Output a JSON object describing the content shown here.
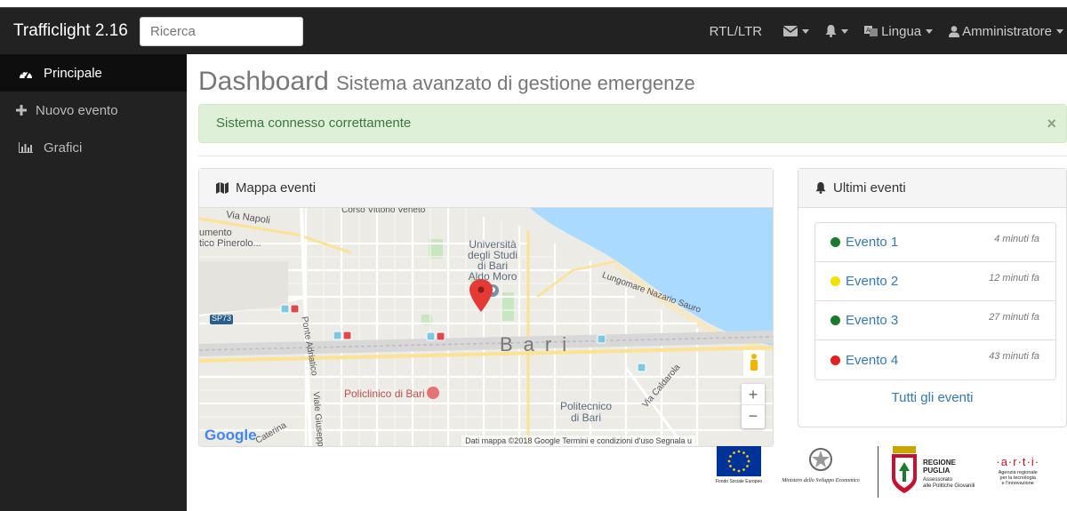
{
  "app": {
    "title": "Trafficlight 2.16"
  },
  "search": {
    "placeholder": "Ricerca"
  },
  "nav": {
    "rtl_ltr": "RTL/LTR",
    "messages_icon": "envelope-icon",
    "alerts_icon": "bell-icon",
    "language": "Lingua",
    "user": "Amministratore"
  },
  "sidebar": {
    "items": [
      {
        "label": "Principale",
        "icon": "dashboard-icon",
        "active": true
      },
      {
        "label": "Nuovo evento",
        "icon": "plus-icon"
      },
      {
        "label": "Grafici",
        "icon": "bar-chart-icon"
      }
    ]
  },
  "page": {
    "title": "Dashboard",
    "subtitle": "Sistema avanzato di gestione emergenze"
  },
  "alert": {
    "text": "Sistema connesso correttamente",
    "close": "×",
    "color": "#dff0d8"
  },
  "map_panel": {
    "title": "Mappa eventi",
    "labels": {
      "via_napoli": "Via Napoli",
      "vittorio_veneto": "Corso Vittorio Veneto",
      "monumento": "umento",
      "pinerolo": "tico Pinerolo...",
      "universita": [
        "Università",
        "degli Studi",
        "di Bari",
        "Aldo Moro"
      ],
      "lungomare": "Lungomare Nazario Sauro",
      "sp73": "SP73",
      "ponte": "Ponte Adriatico",
      "bari": "Bari",
      "via_caldarola": "Via Caldarola",
      "policlinico": "Policlinico di Bari",
      "politecnico": [
        "Politecnico",
        "di Bari"
      ],
      "viale": "Viale Giuseppe",
      "caterina": "Caterina"
    },
    "google": "Google",
    "attribution": "Dati mappa ©2018 Google    Termini e condizioni d'uso    Segnala u",
    "zoom_in": "+",
    "zoom_out": "−"
  },
  "events_panel": {
    "title": "Ultimi eventi",
    "events": [
      {
        "name": "Evento 1",
        "time": "4 minuti fa",
        "color": "#1a7a2e"
      },
      {
        "name": "Evento 2",
        "time": "12 minuti fa",
        "color": "#f2e200"
      },
      {
        "name": "Evento 3",
        "time": "27 minuti fa",
        "color": "#1a7a2e"
      },
      {
        "name": "Evento 4",
        "time": "43 minuti fa",
        "color": "#e0201c"
      }
    ],
    "all_link": "Tutti gli eventi"
  },
  "footer": {
    "eu": "Fondo Sociale Europeo",
    "ministero": "Ministero dello Sviluppo Economico",
    "regione": [
      "REGIONE",
      "PUGLIA"
    ],
    "assessorato": [
      "Assessorato",
      "alle Politiche Giovanili"
    ],
    "arti": "·a·r·t·i·",
    "arti_desc": [
      "Agenzia regionale",
      "per la tecnologia",
      "e l'innovazione"
    ]
  }
}
